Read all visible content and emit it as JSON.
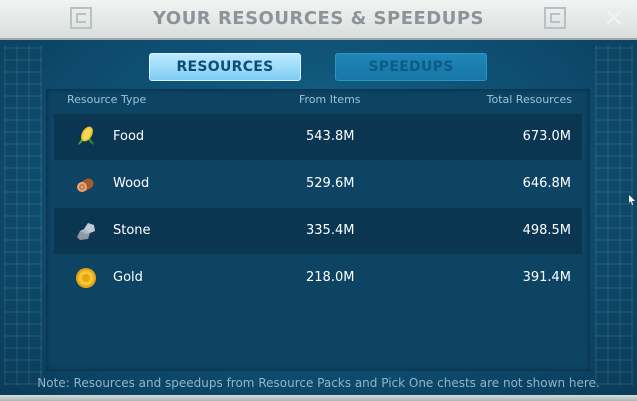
{
  "header": {
    "title": "YOUR RESOURCES & SPEEDUPS",
    "close_label": "✕"
  },
  "tabs": [
    {
      "label": "RESOURCES",
      "active": true
    },
    {
      "label": "SPEEDUPS",
      "active": false
    }
  ],
  "table": {
    "columns": [
      "Resource Type",
      "From Items",
      "Total Resources"
    ],
    "rows": [
      {
        "icon": "corn-icon",
        "name": "Food",
        "from_items": "543.8M",
        "total": "673.0M"
      },
      {
        "icon": "log-icon",
        "name": "Wood",
        "from_items": "529.6M",
        "total": "646.8M"
      },
      {
        "icon": "stone-icon",
        "name": "Stone",
        "from_items": "335.4M",
        "total": "498.5M"
      },
      {
        "icon": "gold-coin-icon",
        "name": "Gold",
        "from_items": "218.0M",
        "total": "391.4M"
      }
    ]
  },
  "note": "Note: Resources and speedups from Resource Packs and Pick One chests are not shown here.",
  "colors": {
    "accent_tab": "#9edcf8",
    "panel": "#0d4464",
    "background": "#0f5276"
  }
}
